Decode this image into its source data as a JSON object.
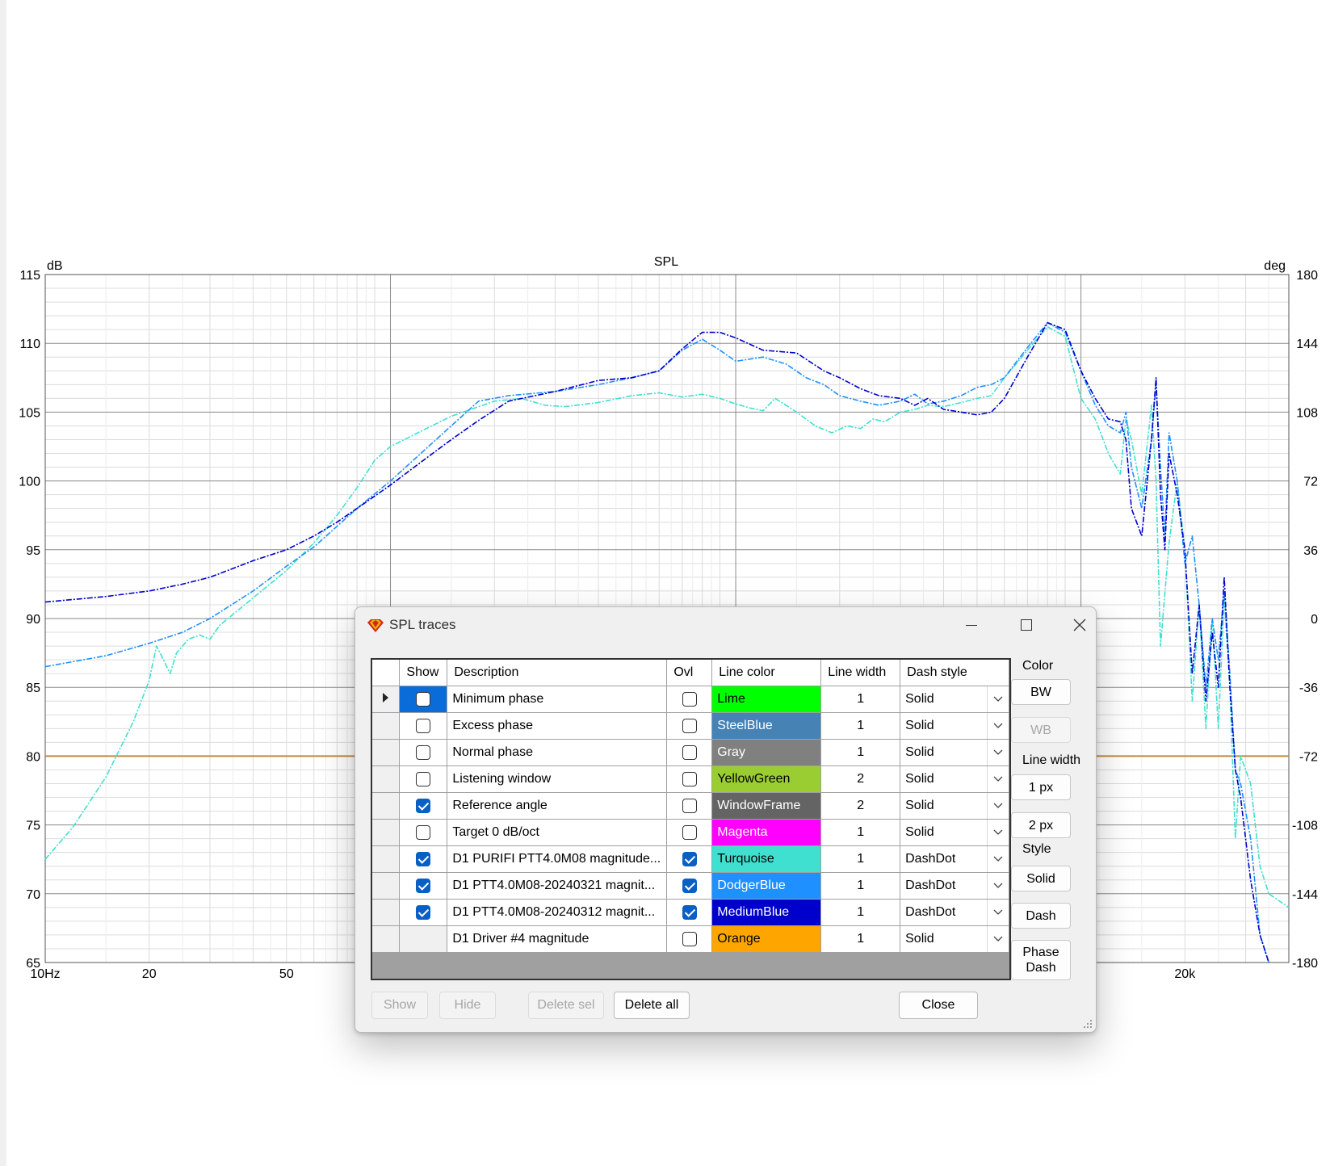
{
  "chart_data": {
    "type": "line",
    "title": "SPL",
    "left_unit": "dB",
    "right_unit": "deg",
    "x_scale": "log",
    "xlim": [
      10,
      40000
    ],
    "ylim": [
      65,
      115
    ],
    "y2lim": [
      -180,
      180
    ],
    "y_ticks": [
      "115",
      "110",
      "105",
      "100",
      "95",
      "90",
      "85",
      "80",
      "75",
      "70",
      "65"
    ],
    "y2_ticks": [
      "180",
      "144",
      "108",
      "72",
      "36",
      "0",
      "-36",
      "-72",
      "-108",
      "-144",
      "-180"
    ],
    "x_ticks": [
      {
        "value": 10,
        "label": "10Hz"
      },
      {
        "value": 20,
        "label": "20"
      },
      {
        "value": 50,
        "label": "50"
      },
      {
        "value": 20000,
        "label": "20k"
      }
    ],
    "grid": true,
    "reference_line": {
      "y": 80,
      "color": "#c08a3c"
    },
    "series": [
      {
        "name": "D1 PURIFI PTT4.0M08 magnitude",
        "color": "#40e0d0",
        "dash": "DashDot",
        "points": [
          [
            10,
            72.5
          ],
          [
            12,
            74.8
          ],
          [
            15,
            78.5
          ],
          [
            18,
            82.5
          ],
          [
            20,
            85.5
          ],
          [
            21,
            88
          ],
          [
            22,
            87
          ],
          [
            23,
            86
          ],
          [
            24,
            87.5
          ],
          [
            26,
            88.5
          ],
          [
            28,
            88.8
          ],
          [
            30,
            88.5
          ],
          [
            32,
            89.5
          ],
          [
            40,
            91.5
          ],
          [
            50,
            93.5
          ],
          [
            60,
            95.5
          ],
          [
            70,
            97.5
          ],
          [
            80,
            99.5
          ],
          [
            90,
            101.5
          ],
          [
            100,
            102.5
          ],
          [
            120,
            103.5
          ],
          [
            150,
            104.7
          ],
          [
            200,
            105.8
          ],
          [
            240,
            106
          ],
          [
            280,
            105.5
          ],
          [
            320,
            105.4
          ],
          [
            400,
            105.7
          ],
          [
            500,
            106.2
          ],
          [
            600,
            106.4
          ],
          [
            700,
            106.1
          ],
          [
            800,
            106.3
          ],
          [
            900,
            106
          ],
          [
            1000,
            105.6
          ],
          [
            1100,
            105.3
          ],
          [
            1200,
            105.1
          ],
          [
            1300,
            106
          ],
          [
            1400,
            105.5
          ],
          [
            1500,
            105
          ],
          [
            1700,
            104
          ],
          [
            1900,
            103.5
          ],
          [
            2100,
            104
          ],
          [
            2300,
            103.8
          ],
          [
            2500,
            104.5
          ],
          [
            2700,
            104.3
          ],
          [
            3000,
            105
          ],
          [
            3300,
            105.2
          ],
          [
            3600,
            105.5
          ],
          [
            4000,
            105.4
          ],
          [
            4500,
            105.7
          ],
          [
            5000,
            106
          ],
          [
            5500,
            106.2
          ],
          [
            6000,
            107.5
          ],
          [
            7000,
            109.5
          ],
          [
            8000,
            111.2
          ],
          [
            9000,
            110.5
          ],
          [
            10000,
            106
          ],
          [
            11000,
            104.5
          ],
          [
            12000,
            102
          ],
          [
            13000,
            100.5
          ],
          [
            13500,
            104.5
          ],
          [
            14000,
            103
          ],
          [
            15000,
            99
          ],
          [
            16000,
            105.5
          ],
          [
            16500,
            100
          ],
          [
            17000,
            88
          ],
          [
            18000,
            95.5
          ],
          [
            19000,
            100
          ],
          [
            20000,
            95
          ],
          [
            21000,
            84
          ],
          [
            22000,
            91
          ],
          [
            23000,
            82
          ],
          [
            24000,
            90
          ],
          [
            25000,
            82
          ],
          [
            26000,
            91.5
          ],
          [
            27000,
            85
          ],
          [
            28000,
            74
          ],
          [
            29000,
            80
          ],
          [
            31000,
            78
          ],
          [
            33000,
            72
          ],
          [
            35000,
            70
          ],
          [
            40000,
            69
          ]
        ]
      },
      {
        "name": "D1 PTT4.0M08-20240321 magnitude",
        "color": "#1e90ff",
        "dash": "DashDot",
        "points": [
          [
            10,
            86.5
          ],
          [
            15,
            87.3
          ],
          [
            20,
            88.2
          ],
          [
            25,
            89
          ],
          [
            30,
            90
          ],
          [
            40,
            92
          ],
          [
            50,
            93.8
          ],
          [
            60,
            95.2
          ],
          [
            70,
            96.7
          ],
          [
            80,
            98
          ],
          [
            100,
            100
          ],
          [
            120,
            101.8
          ],
          [
            150,
            104
          ],
          [
            180,
            105.8
          ],
          [
            220,
            106.2
          ],
          [
            300,
            106.5
          ],
          [
            400,
            107
          ],
          [
            500,
            107.5
          ],
          [
            600,
            108
          ],
          [
            700,
            109.5
          ],
          [
            800,
            110.3
          ],
          [
            900,
            109.5
          ],
          [
            1000,
            108.7
          ],
          [
            1200,
            109
          ],
          [
            1400,
            108.5
          ],
          [
            1600,
            107.5
          ],
          [
            1800,
            107
          ],
          [
            2000,
            106.2
          ],
          [
            2300,
            105.8
          ],
          [
            2600,
            105.5
          ],
          [
            3000,
            105.8
          ],
          [
            3300,
            106.3
          ],
          [
            3600,
            105.6
          ],
          [
            4000,
            105.8
          ],
          [
            4500,
            106.2
          ],
          [
            5000,
            106.8
          ],
          [
            5500,
            107
          ],
          [
            6000,
            107.5
          ],
          [
            7000,
            109.7
          ],
          [
            8000,
            111.5
          ],
          [
            9000,
            110.8
          ],
          [
            10000,
            108
          ],
          [
            11000,
            105.5
          ],
          [
            12000,
            104
          ],
          [
            13000,
            103.5
          ],
          [
            13500,
            105
          ],
          [
            14000,
            101
          ],
          [
            15000,
            98
          ],
          [
            16000,
            103
          ],
          [
            16500,
            107
          ],
          [
            17000,
            101
          ],
          [
            17500,
            96
          ],
          [
            18000,
            103.5
          ],
          [
            19000,
            100
          ],
          [
            20000,
            94
          ],
          [
            21000,
            96
          ],
          [
            22000,
            91
          ],
          [
            23000,
            85
          ],
          [
            24000,
            90
          ],
          [
            25000,
            87
          ],
          [
            26000,
            92
          ],
          [
            27000,
            86
          ],
          [
            28000,
            79
          ],
          [
            29000,
            78
          ],
          [
            31000,
            74
          ],
          [
            33000,
            67
          ],
          [
            35000,
            64
          ]
        ]
      },
      {
        "name": "D1 PTT4.0M08-20240312 magnitude",
        "color": "#0000cd",
        "dash": "DashDot",
        "points": [
          [
            10,
            91.2
          ],
          [
            15,
            91.6
          ],
          [
            20,
            92
          ],
          [
            25,
            92.5
          ],
          [
            30,
            93
          ],
          [
            40,
            94.2
          ],
          [
            50,
            95
          ],
          [
            60,
            96
          ],
          [
            70,
            97
          ],
          [
            80,
            98
          ],
          [
            100,
            99.7
          ],
          [
            120,
            101.2
          ],
          [
            150,
            103
          ],
          [
            180,
            104.4
          ],
          [
            220,
            105.8
          ],
          [
            300,
            106.5
          ],
          [
            400,
            107.3
          ],
          [
            500,
            107.5
          ],
          [
            600,
            108
          ],
          [
            700,
            109.6
          ],
          [
            800,
            110.8
          ],
          [
            900,
            110.8
          ],
          [
            1000,
            110.4
          ],
          [
            1200,
            109.5
          ],
          [
            1500,
            109.3
          ],
          [
            1800,
            108
          ],
          [
            2000,
            107.5
          ],
          [
            2300,
            106.7
          ],
          [
            2600,
            106.2
          ],
          [
            3000,
            106
          ],
          [
            3300,
            105.5
          ],
          [
            3600,
            106
          ],
          [
            4000,
            105.2
          ],
          [
            4500,
            105
          ],
          [
            5000,
            104.8
          ],
          [
            5500,
            105
          ],
          [
            6000,
            106
          ],
          [
            7000,
            109
          ],
          [
            8000,
            111.5
          ],
          [
            9000,
            111
          ],
          [
            10000,
            108
          ],
          [
            11000,
            106
          ],
          [
            12000,
            104.5
          ],
          [
            13000,
            104.3
          ],
          [
            13500,
            103
          ],
          [
            14000,
            98
          ],
          [
            15000,
            96
          ],
          [
            16000,
            103
          ],
          [
            16500,
            107.5
          ],
          [
            17000,
            99
          ],
          [
            17500,
            95
          ],
          [
            18000,
            102
          ],
          [
            19000,
            99
          ],
          [
            20000,
            95
          ],
          [
            21000,
            86
          ],
          [
            22000,
            91
          ],
          [
            23000,
            84
          ],
          [
            24000,
            89
          ],
          [
            25000,
            85
          ],
          [
            26000,
            93
          ],
          [
            27000,
            85
          ],
          [
            28000,
            79
          ],
          [
            29000,
            77
          ],
          [
            31000,
            71
          ],
          [
            33000,
            67
          ],
          [
            35000,
            64
          ]
        ]
      }
    ]
  },
  "dialog": {
    "title": "SPL traces",
    "columns": {
      "show": "Show",
      "description": "Description",
      "ovl": "Ovl",
      "line_color": "Line color",
      "line_width": "Line width",
      "dash_style": "Dash style"
    },
    "rows": [
      {
        "show": false,
        "description": "Minimum phase",
        "ovl": false,
        "color_name": "Lime",
        "color": "#00ff00",
        "text_color": "#000000",
        "width": "1",
        "dash": "Solid",
        "current": true
      },
      {
        "show": false,
        "description": "Excess phase",
        "ovl": false,
        "color_name": "SteelBlue",
        "color": "#4682b4",
        "text_color": "#ffffff",
        "width": "1",
        "dash": "Solid"
      },
      {
        "show": false,
        "description": "Normal phase",
        "ovl": false,
        "color_name": "Gray",
        "color": "#808080",
        "text_color": "#ffffff",
        "width": "1",
        "dash": "Solid"
      },
      {
        "show": false,
        "description": "Listening window",
        "ovl": false,
        "color_name": "YellowGreen",
        "color": "#9acd32",
        "text_color": "#000000",
        "width": "2",
        "dash": "Solid"
      },
      {
        "show": true,
        "description": "Reference angle",
        "ovl": false,
        "color_name": "WindowFrame",
        "color": "#646464",
        "text_color": "#ffffff",
        "width": "2",
        "dash": "Solid"
      },
      {
        "show": false,
        "description": "Target 0 dB/oct",
        "ovl": false,
        "color_name": "Magenta",
        "color": "#ff00ff",
        "text_color": "#ffffff",
        "width": "1",
        "dash": "Solid"
      },
      {
        "show": true,
        "description": "D1 PURIFI PTT4.0M08 magnitude...",
        "ovl": true,
        "color_name": "Turquoise",
        "color": "#40e0d0",
        "text_color": "#000000",
        "width": "1",
        "dash": "DashDot"
      },
      {
        "show": true,
        "description": "D1 PTT4.0M08-20240321 magnit...",
        "ovl": true,
        "color_name": "DodgerBlue",
        "color": "#1e90ff",
        "text_color": "#ffffff",
        "width": "1",
        "dash": "DashDot"
      },
      {
        "show": true,
        "description": "D1 PTT4.0M08-20240312 magnit...",
        "ovl": true,
        "color_name": "MediumBlue",
        "color": "#0000cd",
        "text_color": "#ffffff",
        "width": "1",
        "dash": "DashDot"
      },
      {
        "show": null,
        "description": "D1 Driver #4 magnitude",
        "ovl": false,
        "color_name": "Orange",
        "color": "#ffa500",
        "text_color": "#000000",
        "width": "1",
        "dash": "Solid"
      }
    ],
    "side": {
      "color_label": "Color",
      "bw": "BW",
      "wb": "WB",
      "line_width_label": "Line width",
      "px1": "1 px",
      "px2": "2 px",
      "style_label": "Style",
      "solid": "Solid",
      "dash": "Dash",
      "phase_dash_1": "Phase",
      "phase_dash_2": "Dash"
    },
    "bottom": {
      "show": "Show",
      "hide": "Hide",
      "delete_sel": "Delete sel",
      "delete_all": "Delete all",
      "close": "Close"
    }
  }
}
